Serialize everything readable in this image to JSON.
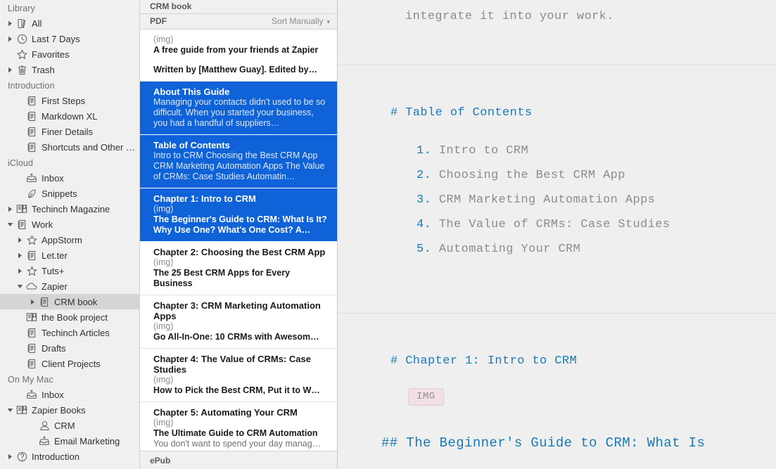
{
  "sidebar": {
    "sections": [
      {
        "header": "Library",
        "items": [
          {
            "label": "All",
            "icon": "books-icon",
            "twisty": "right",
            "indent": 0
          },
          {
            "label": "Last 7 Days",
            "icon": "clock-icon",
            "twisty": "right",
            "indent": 0
          },
          {
            "label": "Favorites",
            "icon": "star-icon",
            "twisty": "none",
            "indent": 0
          },
          {
            "label": "Trash",
            "icon": "trash-icon",
            "twisty": "right",
            "indent": 0
          }
        ]
      },
      {
        "header": "Introduction",
        "items": [
          {
            "label": "First Steps",
            "icon": "document-icon",
            "twisty": "none",
            "indent": 1
          },
          {
            "label": "Markdown XL",
            "icon": "document-icon",
            "twisty": "none",
            "indent": 1
          },
          {
            "label": "Finer Details",
            "icon": "document-icon",
            "twisty": "none",
            "indent": 1
          },
          {
            "label": "Shortcuts and Other Tips",
            "icon": "document-icon",
            "twisty": "none",
            "indent": 1
          }
        ]
      },
      {
        "header": "iCloud",
        "items": [
          {
            "label": "Inbox",
            "icon": "inbox-icon",
            "twisty": "none",
            "indent": 1
          },
          {
            "label": "Snippets",
            "icon": "pen-icon",
            "twisty": "none",
            "indent": 1
          },
          {
            "label": "Techinch Magazine",
            "icon": "book-icon",
            "twisty": "right",
            "indent": 0
          },
          {
            "label": "Work",
            "icon": "document-icon",
            "twisty": "down",
            "indent": 0
          },
          {
            "label": "AppStorm",
            "icon": "star-icon",
            "twisty": "right",
            "indent": 1
          },
          {
            "label": "Let.ter",
            "icon": "document-icon",
            "twisty": "right",
            "indent": 1
          },
          {
            "label": "Tuts+",
            "icon": "star-icon",
            "twisty": "right",
            "indent": 1
          },
          {
            "label": "Zapier",
            "icon": "cloud-icon",
            "twisty": "down",
            "indent": 1
          },
          {
            "label": "CRM book",
            "icon": "document-icon",
            "twisty": "right",
            "indent": 2,
            "selected": true
          },
          {
            "label": "the Book project",
            "icon": "book-icon",
            "twisty": "none",
            "indent": 1
          },
          {
            "label": "Techinch Articles",
            "icon": "document-icon",
            "twisty": "none",
            "indent": 1
          },
          {
            "label": "Drafts",
            "icon": "document-icon",
            "twisty": "none",
            "indent": 1
          },
          {
            "label": "Client Projects",
            "icon": "document-icon",
            "twisty": "none",
            "indent": 1
          }
        ]
      },
      {
        "header": "On My Mac",
        "items": [
          {
            "label": "Inbox",
            "icon": "inbox-icon",
            "twisty": "none",
            "indent": 1
          },
          {
            "label": "Zapier Books",
            "icon": "book-icon",
            "twisty": "down",
            "indent": 0
          },
          {
            "label": "CRM",
            "icon": "person-icon",
            "twisty": "none",
            "indent": 2
          },
          {
            "label": "Email Marketing",
            "icon": "inbox-icon",
            "twisty": "none",
            "indent": 2
          },
          {
            "label": "Introduction",
            "icon": "question-icon",
            "twisty": "right",
            "indent": 0
          }
        ]
      }
    ]
  },
  "list": {
    "title": "CRM book",
    "format": "PDF",
    "sort_label": "Sort Manually",
    "sort_chevron": "chevron-down-icon",
    "footer": "ePub",
    "documents": [
      {
        "title": "",
        "img": "(img)",
        "sub": "A free guide from your friends at Zapier",
        "preview2": "Written by [Matthew Guay]. Edited by…",
        "selected": false
      },
      {
        "title": "About This Guide",
        "img": "",
        "sub": "",
        "preview": "Managing your contacts didn't used to be so difficult. When you started your business, you had a handful of suppliers…",
        "selected": true
      },
      {
        "title": "Table of Contents",
        "img": "",
        "sub": "",
        "preview": "Intro to CRM Choosing the Best CRM App CRM Marketing Automation Apps The Value of CRMs: Case Studies Automatin…",
        "selected": true
      },
      {
        "title": "Chapter 1: Intro to CRM",
        "img": "(img)",
        "sub": "The Beginner's Guide to CRM: What Is It? Why Use One? What's One Cost? A…",
        "selected": true
      },
      {
        "title": "Chapter 2: Choosing the Best CRM App",
        "img": "(img)",
        "sub": "The 25 Best CRM Apps for Every Business",
        "selected": false
      },
      {
        "title": "Chapter 3: CRM Marketing Automation Apps",
        "img": "(img)",
        "sub": "Go All-In-One: 10 CRMs with Awesom…",
        "selected": false
      },
      {
        "title": "Chapter 4: The Value of CRMs: Case Studies",
        "img": "(img)",
        "sub": "How to Pick the Best CRM, Put it to W…",
        "selected": false
      },
      {
        "title": "Chapter 5: Automating Your CRM",
        "img": "(img)",
        "sub": "The Ultimate Guide to CRM Automation",
        "preview": "You don't want to spend your day manag…",
        "selected": false
      }
    ]
  },
  "editor": {
    "top_line": "integrate it into your work.",
    "toc_heading": "# Table of Contents",
    "toc_items": [
      {
        "num": "1.",
        "text": "Intro to CRM"
      },
      {
        "num": "2.",
        "text": "Choosing the Best CRM App"
      },
      {
        "num": "3.",
        "text": "CRM Marketing Automation Apps"
      },
      {
        "num": "4.",
        "text": "The Value of CRMs: Case Studies"
      },
      {
        "num": "5.",
        "text": "Automating Your CRM"
      }
    ],
    "chapter_heading": "# Chapter 1: Intro to CRM",
    "image_token": "IMG",
    "sub_heading": "## The Beginner's Guide to CRM: What Is"
  },
  "colors": {
    "selection_blue": "#0f62d8",
    "heading_blue": "#1a7ab5",
    "sidebar_bg": "#f0f0f0",
    "editor_bg": "#efefef",
    "sidebar_selected": "#d5d5d5"
  }
}
